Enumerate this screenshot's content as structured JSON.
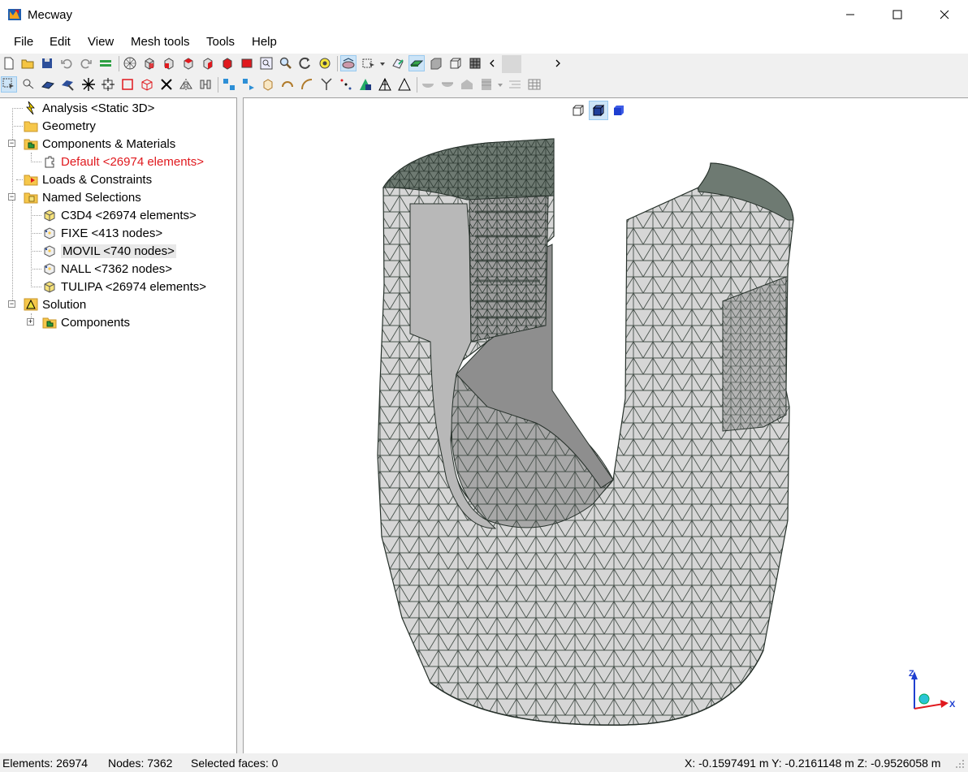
{
  "window": {
    "title": "Mecway"
  },
  "menu": {
    "file": "File",
    "edit": "Edit",
    "view": "View",
    "mesh_tools": "Mesh tools",
    "tools": "Tools",
    "help": "Help"
  },
  "tree": {
    "analysis": "Analysis <Static 3D>",
    "geometry": "Geometry",
    "components_materials": "Components & Materials",
    "default_component": "Default <26974 elements>",
    "loads_constraints": "Loads & Constraints",
    "named_selections": "Named Selections",
    "sel_c3d4": "C3D4 <26974 elements>",
    "sel_fixe": "FIXE <413 nodes>",
    "sel_movil": "MOVIL <740 nodes>",
    "sel_nall": "NALL <7362 nodes>",
    "sel_tulipa": "TULIPA <26974 elements>",
    "solution": "Solution",
    "solution_components": "Components"
  },
  "status": {
    "elements": "Elements: 26974",
    "nodes": "Nodes: 7362",
    "selected_faces": "Selected faces: 0",
    "coords": "X: -0.1597491 m Y: -0.2161148 m Z: -0.9526058 m"
  },
  "axes": {
    "x": "X",
    "z": "Z"
  },
  "colors": {
    "accent_red": "#e0191e",
    "mesh_fill": "#d4d4d4",
    "mesh_edge": "#2e3a33"
  }
}
